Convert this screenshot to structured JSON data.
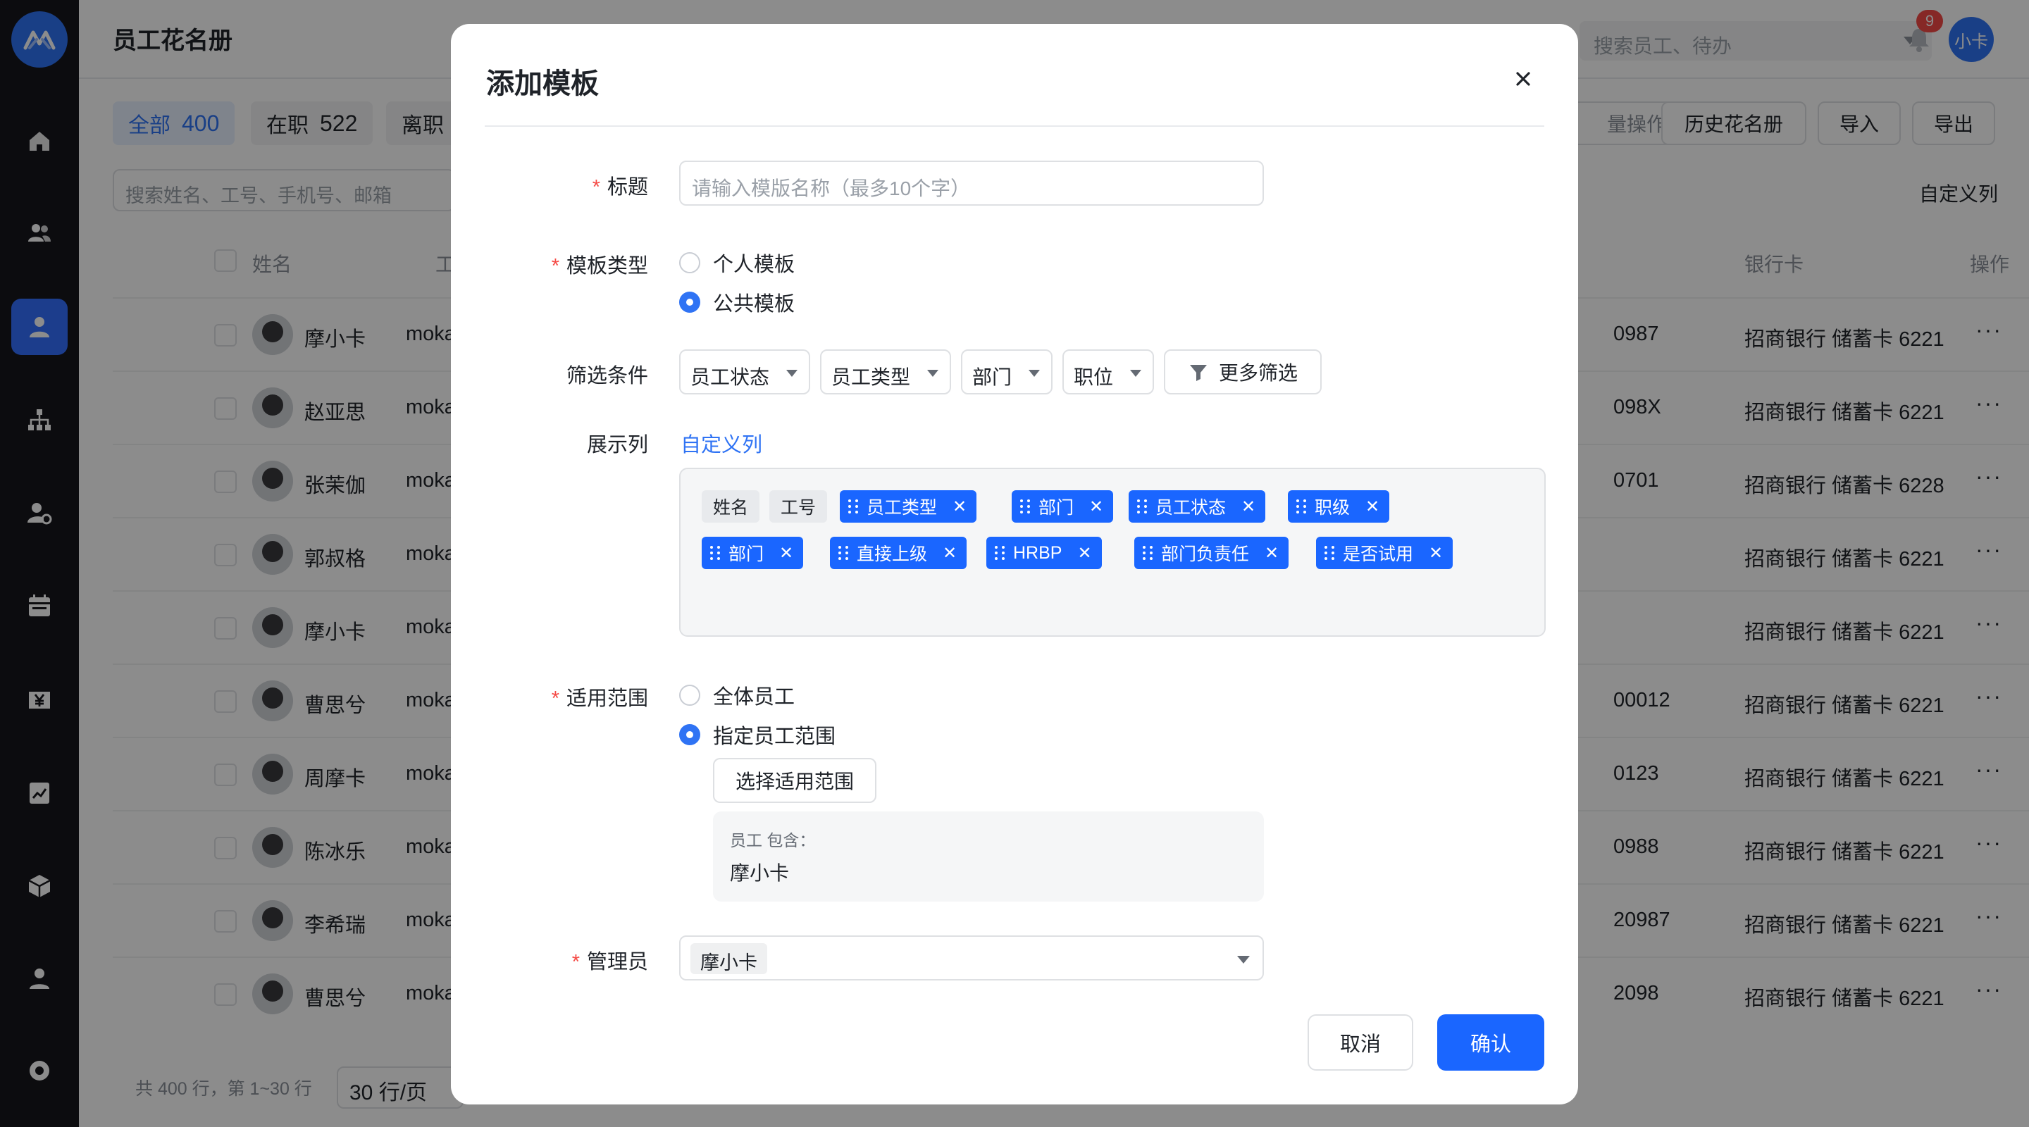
{
  "page": {
    "title": "员工花名册",
    "top_search_placeholder": "搜索员工、待办",
    "notification_count": "9",
    "user_avatar": "小卡"
  },
  "sidebar": {
    "items": [
      {
        "icon": "home-icon"
      },
      {
        "icon": "users-icon"
      },
      {
        "icon": "person-icon",
        "active": true
      },
      {
        "icon": "org-chart-icon"
      },
      {
        "icon": "user-settings-icon"
      },
      {
        "icon": "calendar-icon"
      },
      {
        "icon": "yen-icon"
      },
      {
        "icon": "report-icon"
      },
      {
        "icon": "cube-icon"
      },
      {
        "icon": "profile-icon"
      },
      {
        "icon": "settings-icon"
      }
    ]
  },
  "status_tabs": [
    {
      "label": "全部",
      "count": "400",
      "active": true
    },
    {
      "label": "在职",
      "count": "522"
    },
    {
      "label": "离职",
      "count": ""
    }
  ],
  "toolbar": {
    "batch_label": "量操作",
    "history_label": "历史花名册",
    "import_label": "导入",
    "export_label": "导出",
    "search_placeholder": "搜索姓名、工号、手机号、邮箱",
    "custom_columns": "自定义列"
  },
  "table": {
    "headers": {
      "name": "姓名",
      "emp_no": "工号",
      "bank": "银行卡",
      "action": "操作"
    },
    "rows": [
      {
        "name": "摩小卡",
        "emp": "moka",
        "bank_tail": "0987",
        "bank": "招商银行 储蓄卡 6221"
      },
      {
        "name": "赵亚思",
        "emp": "moka",
        "bank_tail": "098X",
        "bank": "招商银行 储蓄卡 6221"
      },
      {
        "name": "张茉伽",
        "emp": "moka",
        "bank_tail": "0701",
        "bank": "招商银行 储蓄卡 6228"
      },
      {
        "name": "郭叔格",
        "emp": "moka",
        "bank_tail": "",
        "bank": "招商银行 储蓄卡 6221"
      },
      {
        "name": "摩小卡",
        "emp": "moka",
        "bank_tail": "",
        "bank": "招商银行 储蓄卡 6221"
      },
      {
        "name": "曹思兮",
        "emp": "moka",
        "bank_tail": "00012",
        "bank": "招商银行 储蓄卡 6221"
      },
      {
        "name": "周摩卡",
        "emp": "moka",
        "bank_tail": "0123",
        "bank": "招商银行 储蓄卡 6221"
      },
      {
        "name": "陈冰乐",
        "emp": "moka",
        "bank_tail": "0988",
        "bank": "招商银行 储蓄卡 6221"
      },
      {
        "name": "李希瑞",
        "emp": "moka",
        "bank_tail": "20987",
        "bank": "招商银行 储蓄卡 6221"
      },
      {
        "name": "曹思兮",
        "emp": "moka",
        "bank_tail": "2098",
        "bank": "招商银行 储蓄卡 6221"
      }
    ],
    "more_label": "···"
  },
  "footer": {
    "info": "共 400 行，第 1~30 行",
    "page_size": "30 行/页"
  },
  "modal": {
    "title": "添加模板",
    "fields": {
      "title_label": "标题",
      "title_placeholder": "请输入模版名称（最多10个字）",
      "type_label": "模板类型",
      "type_personal": "个人模板",
      "type_public": "公共模板",
      "filter_label": "筛选条件",
      "filters": [
        "员工状态",
        "员工类型",
        "部门",
        "职位"
      ],
      "more_filters": "更多筛选",
      "columns_label": "展示列",
      "columns_link": "自定义列",
      "fixed_columns": [
        "姓名",
        "工号"
      ],
      "columns": [
        "员工类型",
        "部门",
        "员工状态",
        "职级",
        "部门",
        "直接上级",
        "HRBP",
        "部门负责任",
        "是否试用"
      ],
      "scope_label": "适用范围",
      "scope_all": "全体员工",
      "scope_specific": "指定员工范围",
      "select_scope_button": "选择适用范围",
      "scope_includes_label": "员工 包含：",
      "scope_includes_value": "摩小卡",
      "admin_label": "管理员",
      "admin_value": "摩小卡"
    },
    "cancel_label": "取消",
    "confirm_label": "确认"
  },
  "colors": {
    "primary": "#1a66ff",
    "sidebar_bg": "#16161c",
    "required": "#f54a45"
  }
}
